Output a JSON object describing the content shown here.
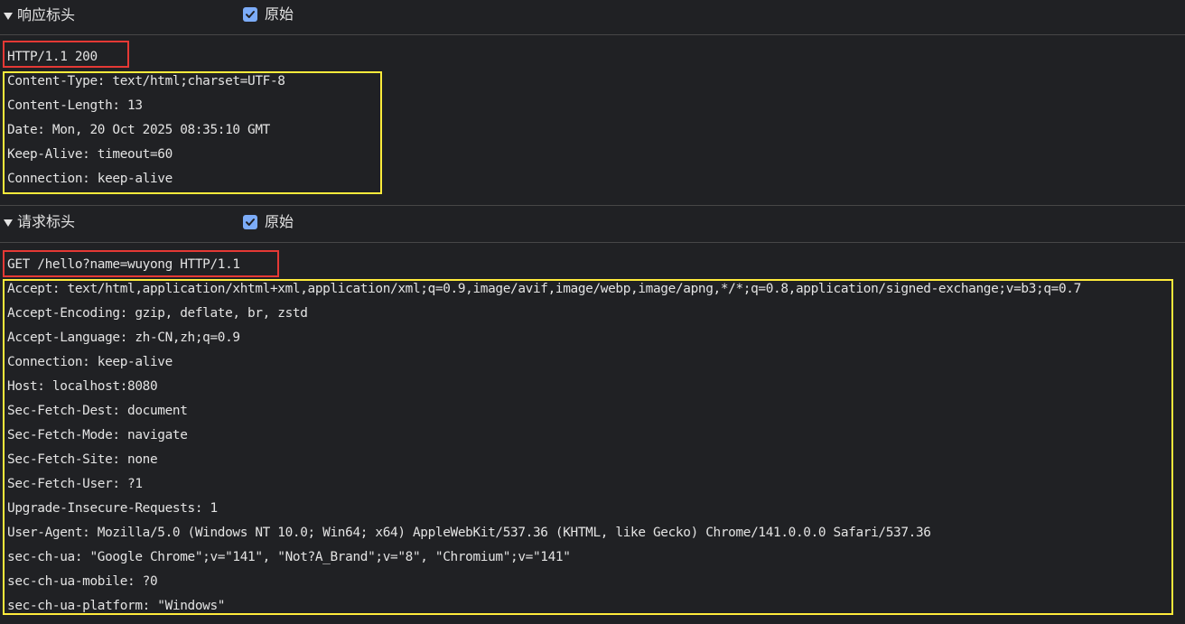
{
  "response": {
    "title": "响应标头",
    "raw_label": "原始",
    "status_line": "HTTP/1.1 200",
    "headers": [
      "Content-Type: text/html;charset=UTF-8",
      "Content-Length: 13",
      "Date: Mon, 20 Oct 2025 08:35:10 GMT",
      "Keep-Alive: timeout=60",
      "Connection: keep-alive"
    ]
  },
  "request": {
    "title": "请求标头",
    "raw_label": "原始",
    "request_line": "GET /hello?name=wuyong HTTP/1.1",
    "headers": [
      "Accept: text/html,application/xhtml+xml,application/xml;q=0.9,image/avif,image/webp,image/apng,*/*;q=0.8,application/signed-exchange;v=b3;q=0.7",
      "Accept-Encoding: gzip, deflate, br, zstd",
      "Accept-Language: zh-CN,zh;q=0.9",
      "Connection: keep-alive",
      "Host: localhost:8080",
      "Sec-Fetch-Dest: document",
      "Sec-Fetch-Mode: navigate",
      "Sec-Fetch-Site: none",
      "Sec-Fetch-User: ?1",
      "Upgrade-Insecure-Requests: 1",
      "User-Agent: Mozilla/5.0 (Windows NT 10.0; Win64; x64) AppleWebKit/537.36 (KHTML, like Gecko) Chrome/141.0.0.0 Safari/537.36",
      "sec-ch-ua: \"Google Chrome\";v=\"141\", \"Not?A_Brand\";v=\"8\", \"Chromium\";v=\"141\"",
      "sec-ch-ua-mobile: ?0",
      "sec-ch-ua-platform: \"Windows\""
    ]
  },
  "colors": {
    "background": "#202124",
    "text": "#e3e3e3",
    "checkbox": "#7cacf8",
    "highlight_red": "#e53935",
    "highlight_yellow": "#ffeb3b"
  },
  "icons": {
    "section_toggle": "triangle-down-icon",
    "checkbox_check": "checkmark-icon"
  }
}
